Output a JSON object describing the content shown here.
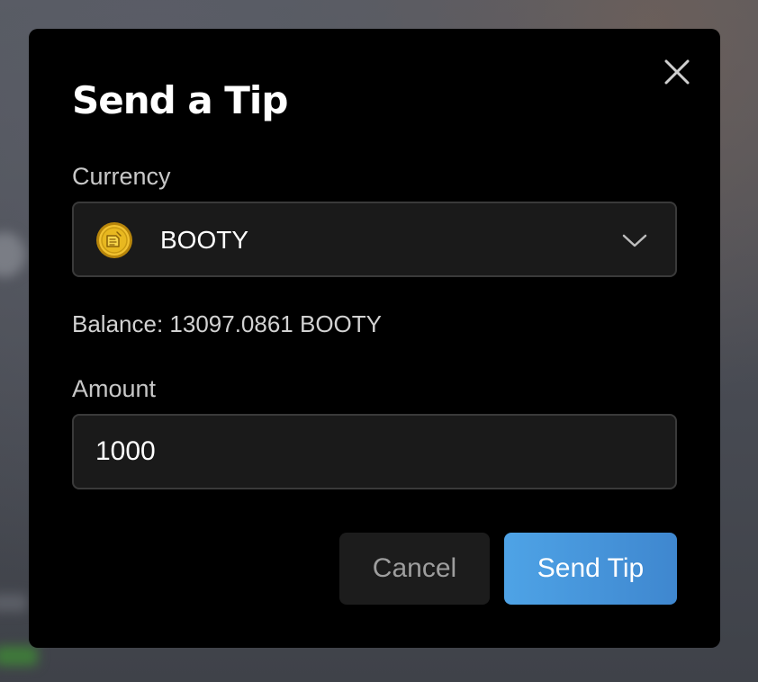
{
  "modal": {
    "title": "Send a Tip",
    "close_icon": "close-icon"
  },
  "currency": {
    "label": "Currency",
    "selected": "BOOTY",
    "icon": "booty-coin-icon",
    "dropdown_icon": "chevron-down-icon"
  },
  "balance": {
    "text": "Balance: 13097.0861 BOOTY"
  },
  "amount": {
    "label": "Amount",
    "value": "1000"
  },
  "actions": {
    "cancel_label": "Cancel",
    "send_label": "Send Tip"
  },
  "colors": {
    "modal_bg": "#000000",
    "field_bg": "#1a1a1a",
    "field_border": "#3a3a3a",
    "accent": "#4a9be0",
    "coin_gold": "#e8b820"
  }
}
